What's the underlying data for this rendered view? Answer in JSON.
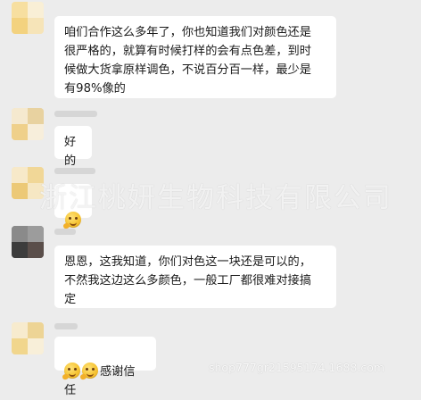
{
  "messages": [
    {
      "text": "咱们合作这么多年了，你也知道我们对颜色还是\n很严格的，就算有时候打样的会有点色差，到时\n候做大货拿原样调色，不说百分百一样，最少是\n有98%像的"
    },
    {
      "text": "好的"
    },
    {
      "text": ""
    },
    {
      "text": "恩恩，这我知道，你们对色这一块还是可以的，\n不然我这边这么多颜色，一般工厂都很难对接搞\n定"
    },
    {
      "text": "感谢信任"
    }
  ],
  "watermark": "浙江桃妍生物科技有限公司",
  "shop_id": "shop777gr21595174.1688.com",
  "emoji": "blush-thumbs-emoji"
}
